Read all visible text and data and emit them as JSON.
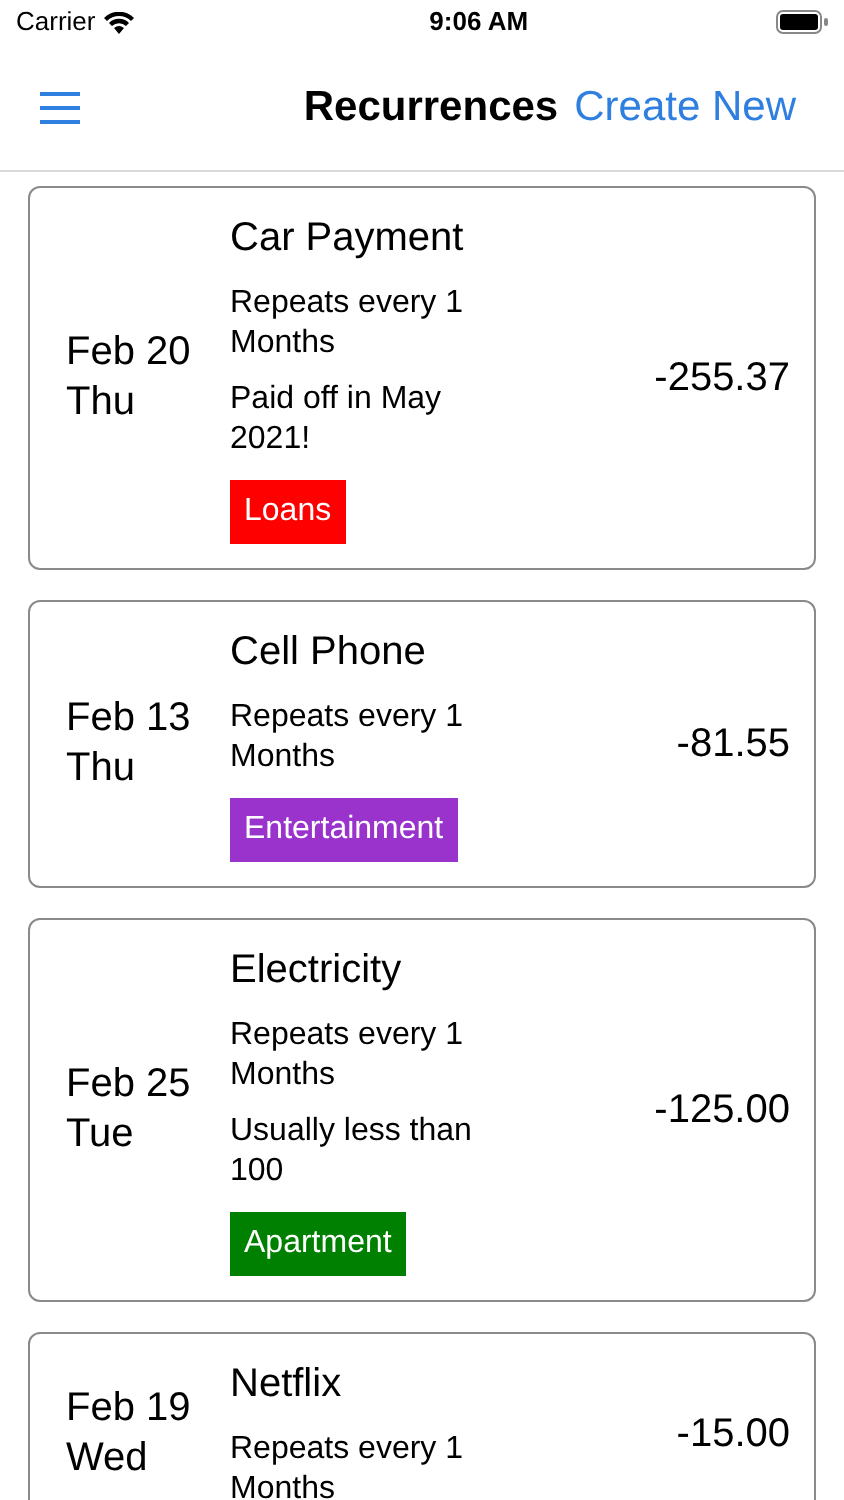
{
  "status_bar": {
    "carrier": "Carrier",
    "time": "9:06 AM"
  },
  "nav": {
    "title": "Recurrences",
    "action": "Create New"
  },
  "recurrences": [
    {
      "date": "Feb 20",
      "weekday": "Thu",
      "name": "Car Payment",
      "repeat": "Repeats every 1 Months",
      "note": "Paid off in May 2021!",
      "tag": "Loans",
      "color": "#ff0000",
      "amount": "-255.37"
    },
    {
      "date": "Feb 13",
      "weekday": "Thu",
      "name": "Cell Phone",
      "repeat": "Repeats every 1 Months",
      "tag": "Entertainment",
      "color": "#9933cc",
      "amount": "-81.55"
    },
    {
      "date": "Feb 25",
      "weekday": "Tue",
      "name": "Electricity",
      "repeat": "Repeats every 1 Months",
      "note": "Usually less than 100",
      "tag": "Apartment",
      "color": "#008000",
      "amount": "-125.00"
    },
    {
      "date": "Feb 19",
      "weekday": "Wed",
      "name": "Netflix",
      "repeat": "Repeats every 1 Months",
      "amount": "-15.00"
    }
  ]
}
